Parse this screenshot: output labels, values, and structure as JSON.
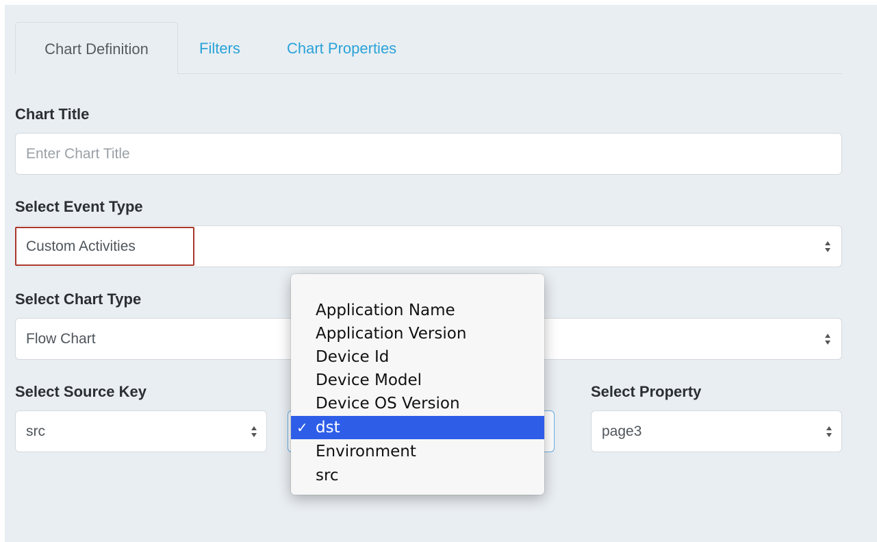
{
  "tabs": [
    {
      "label": "Chart Definition",
      "active": true
    },
    {
      "label": "Filters",
      "active": false
    },
    {
      "label": "Chart Properties",
      "active": false
    }
  ],
  "chart_title": {
    "label": "Chart Title",
    "placeholder": "Enter Chart Title",
    "value": ""
  },
  "event_type": {
    "label": "Select Event Type",
    "value": "Custom Activities"
  },
  "chart_type": {
    "label": "Select Chart Type",
    "value": "Flow Chart"
  },
  "source_key": {
    "label": "Select Source Key",
    "value": "src"
  },
  "property": {
    "label": "Select Property",
    "value": "page3"
  },
  "dropdown": {
    "options": [
      "Application Name",
      "Application Version",
      "Device Id",
      "Device Model",
      "Device OS Version",
      "dst",
      "Environment",
      "src"
    ],
    "selected": "dst",
    "check_glyph": "✓"
  },
  "colors": {
    "panel_bg": "#e9eef2",
    "link": "#2aa3d8",
    "highlight_border": "#a8362a",
    "selection": "#2e5ee8"
  },
  "icons": {
    "select_arrows": "updown-chevron-icon",
    "selected_mark": "checkmark-icon"
  }
}
